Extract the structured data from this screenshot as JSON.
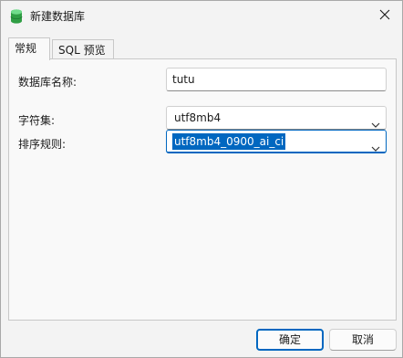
{
  "window": {
    "title": "新建数据库"
  },
  "tabs": [
    {
      "label": "常规",
      "active": true
    },
    {
      "label": "SQL 预览",
      "active": false
    }
  ],
  "form": {
    "name_label": "数据库名称:",
    "name_value": "tutu",
    "charset_label": "字符集:",
    "charset_value": "utf8mb4",
    "collation_label": "排序规则:",
    "collation_value": "utf8mb4_0900_ai_ci"
  },
  "buttons": {
    "ok": "确定",
    "cancel": "取消"
  },
  "colors": {
    "accent": "#0067c0",
    "icon_green": "#2f9e44"
  },
  "icons": {
    "app": "database-icon",
    "close": "close-icon",
    "dropdown": "chevron-down-icon"
  }
}
